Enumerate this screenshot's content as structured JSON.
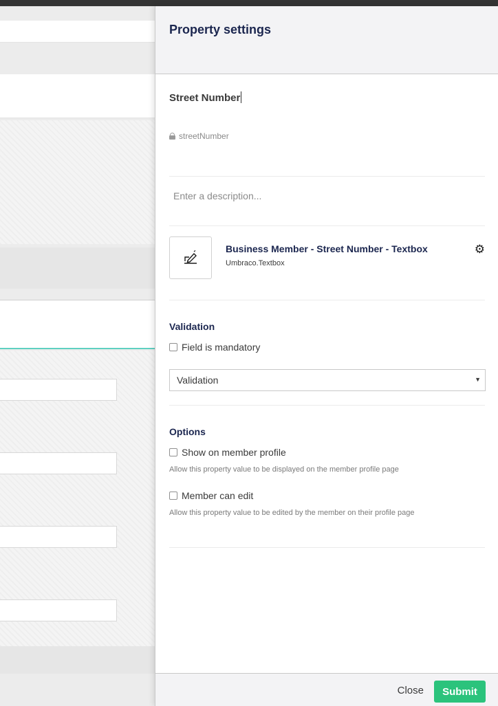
{
  "panel": {
    "title": "Property settings",
    "property_name": "Street Number",
    "alias": "streetNumber",
    "description_placeholder": "Enter a description..."
  },
  "editor": {
    "name": "Business Member - Street Number - Textbox",
    "alias": "Umbraco.Textbox",
    "icon": "editor-pencil-icon",
    "settings_icon": "gear-icon"
  },
  "validation": {
    "title": "Validation",
    "mandatory_label": "Field is mandatory",
    "mandatory_checked": false,
    "select_value": "Validation"
  },
  "options": {
    "title": "Options",
    "show_on_profile_label": "Show on member profile",
    "show_on_profile_hint": "Allow this property value to be displayed on the member profile page",
    "member_can_edit_label": "Member can edit",
    "member_can_edit_hint": "Allow this property value to be edited by the member on their profile page"
  },
  "footer": {
    "close_label": "Close",
    "submit_label": "Submit"
  },
  "colors": {
    "submit": "#2bc37c",
    "title": "#1b264f",
    "accent_line": "#2fc2b0"
  }
}
